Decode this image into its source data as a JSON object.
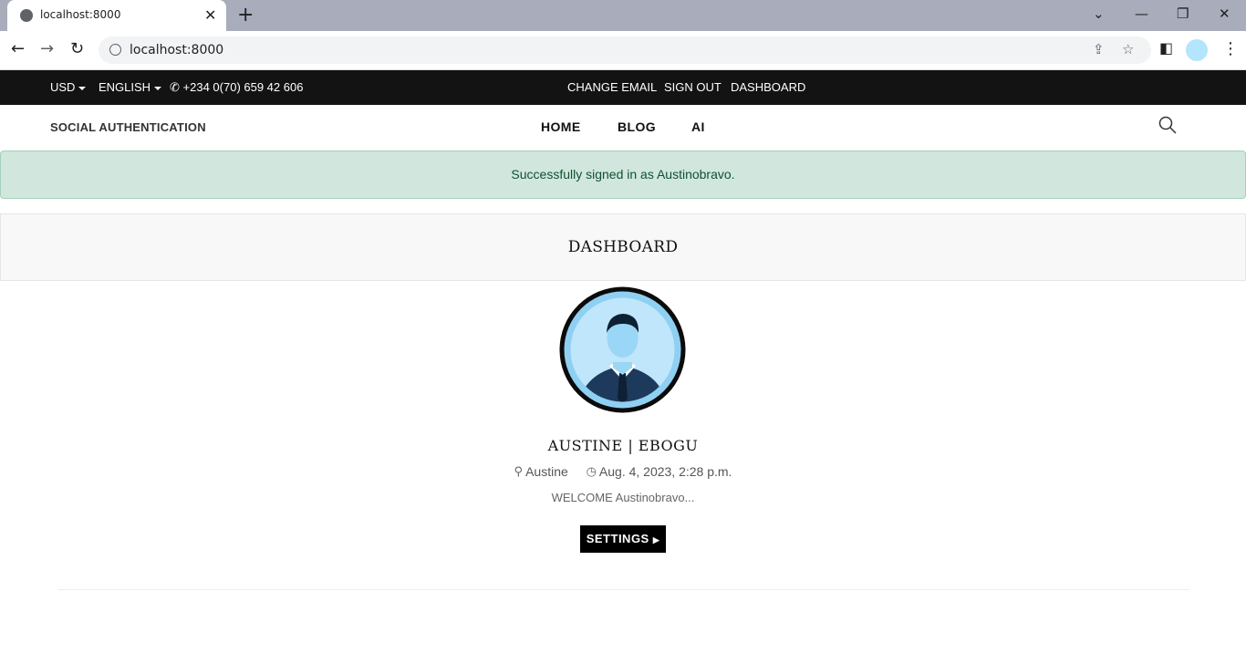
{
  "browser": {
    "tab_title": "localhost:8000",
    "url": "localhost:8000",
    "tab_close_glyph": "✕",
    "new_tab_glyph": "+",
    "win_min": "—",
    "win_max": "❐",
    "win_close": "✕",
    "tab_list": "⌄"
  },
  "topbar": {
    "currency": "USD",
    "language": "ENGLISH",
    "phone": "+234 0(70) 659 42 606",
    "links": [
      "CHANGE EMAIL",
      "SIGN OUT",
      "DASHBOARD"
    ]
  },
  "header": {
    "brand": "SOCIAL AUTHENTICATION",
    "nav": [
      "HOME",
      "BLOG",
      "AI"
    ]
  },
  "alert": {
    "message": "Successfully signed in as Austinobravo.",
    "color": "#d1e7dd"
  },
  "page": {
    "title": "DASHBOARD"
  },
  "profile": {
    "name": "AUSTINE | EBOGU",
    "author": "Austine",
    "date": "Aug. 4, 2023, 2:28 p.m.",
    "welcome": "WELCOME Austinobravo...",
    "settings_label": "SETTINGS"
  }
}
